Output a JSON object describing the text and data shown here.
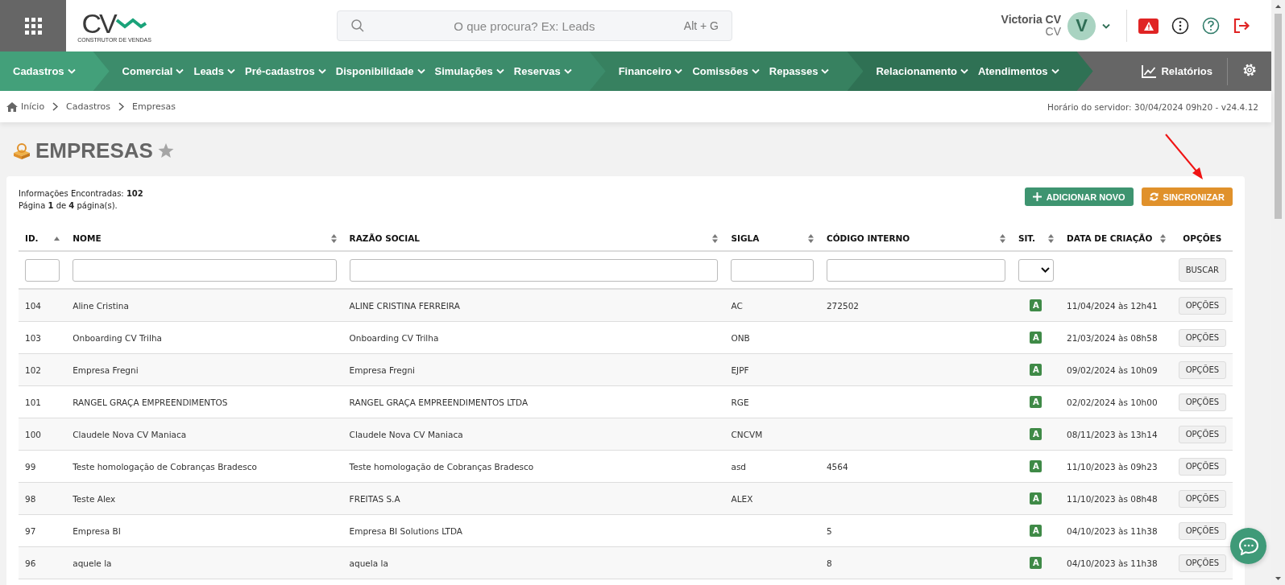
{
  "header": {
    "logo": {
      "mark": "CV",
      "tagline": "CONSTRUTOR DE VENDAS"
    },
    "search": {
      "placeholder": "O que procura? Ex: Leads",
      "shortcut": "Alt + G"
    },
    "user": {
      "name": "Victoria CV",
      "company": "CV",
      "initial": "V"
    }
  },
  "nav": {
    "groups": [
      {
        "color": "#43a07a",
        "items": [
          "Cadastros"
        ]
      },
      {
        "color": "#3c8c6b",
        "items": [
          "Comercial",
          "Leads",
          "Pré-cadastros",
          "Disponibilidade",
          "Simulações",
          "Reservas"
        ]
      },
      {
        "color": "#378160",
        "items": [
          "Financeiro",
          "Comissões",
          "Repasses"
        ]
      },
      {
        "color": "#2f7154",
        "items": [
          "Relacionamento",
          "Atendimentos"
        ]
      }
    ],
    "reports": "Relatórios"
  },
  "breadcrumb": [
    "Início",
    "Cadastros",
    "Empresas"
  ],
  "server_time": "Horário do servidor: 30/04/2024 09h20 - v24.4.12",
  "page": {
    "title": "EMPRESAS",
    "favorite": false
  },
  "summary": [
    "Informações Encontradas: **102**",
    "Página **1** de **4** página(s)."
  ],
  "actions": [
    {
      "kind": "add",
      "label": "ADICIONAR NOVO"
    },
    {
      "kind": "sync",
      "label": "SINCRONIZAR"
    }
  ],
  "table": {
    "columns": [
      {
        "label": "ID.",
        "sortable": true,
        "sorted": true
      },
      {
        "label": "NOME",
        "sortable": true,
        "sorted": false
      },
      {
        "label": "RAZÃO SOCIAL",
        "sortable": true,
        "sorted": false
      },
      {
        "label": "SIGLA",
        "sortable": true,
        "sorted": false
      },
      {
        "label": "CÓDIGO INTERNO",
        "sortable": true,
        "sorted": false
      },
      {
        "label": "SIT.",
        "sortable": true,
        "sorted": false
      },
      {
        "label": "DATA DE CRIAÇÃO",
        "sortable": true,
        "sorted": false
      },
      {
        "label": "OPÇÕES",
        "sortable": false
      }
    ],
    "filters": [
      {
        "kind": "text"
      },
      {
        "kind": "text"
      },
      {
        "kind": "text"
      },
      {
        "kind": "text"
      },
      {
        "kind": "text"
      },
      {
        "kind": "select"
      },
      {
        "kind": "empty"
      },
      {
        "kind": "button",
        "label": "BUSCAR"
      }
    ],
    "rows": [
      {
        "cells": [
          "104",
          "Aline Cristina",
          "ALINE CRISTINA FERREIRA",
          "AC",
          "272502",
          "A",
          "11/04/2024 às 12h41",
          "OPÇÕES"
        ]
      },
      {
        "cells": [
          "103",
          "Onboarding CV Trilha",
          "Onboarding CV Trilha",
          "ONB",
          "",
          "A",
          "21/03/2024 às 08h58",
          "OPÇÕES"
        ]
      },
      {
        "cells": [
          "102",
          "Empresa Fregni",
          "Empresa Fregni",
          "EJPF",
          "",
          "A",
          "09/02/2024 às 10h09",
          "OPÇÕES"
        ]
      },
      {
        "cells": [
          "101",
          "RANGEL GRAÇA EMPREENDIMENTOS",
          "RANGEL GRAÇA EMPREENDIMENTOS LTDA",
          "RGE",
          "",
          "A",
          "02/02/2024 às 10h00",
          "OPÇÕES"
        ]
      },
      {
        "cells": [
          "100",
          "Claudele Nova CV Maniaca",
          "Claudele Nova CV Maniaca",
          "CNCVM",
          "",
          "A",
          "08/11/2023 às 13h14",
          "OPÇÕES"
        ]
      },
      {
        "cells": [
          "99",
          "Teste homologação de Cobranças Bradesco",
          "Teste homologação de Cobranças Bradesco",
          "asd",
          "4564",
          "A",
          "11/10/2023 às 09h23",
          "OPÇÕES"
        ]
      },
      {
        "cells": [
          "98",
          "Teste Alex",
          "FREITAS S.A",
          "ALEX",
          "",
          "A",
          "11/10/2023 às 08h48",
          "OPÇÕES"
        ]
      },
      {
        "cells": [
          "97",
          "Empresa BI",
          "Empresa BI Solutions LTDA",
          "",
          "5",
          "A",
          "04/10/2023 às 11h38",
          "OPÇÕES"
        ]
      },
      {
        "cells": [
          "96",
          "aquele la",
          "aquela la",
          "",
          "8",
          "A",
          "04/10/2023 às 11h38",
          "OPÇÕES"
        ]
      }
    ]
  }
}
